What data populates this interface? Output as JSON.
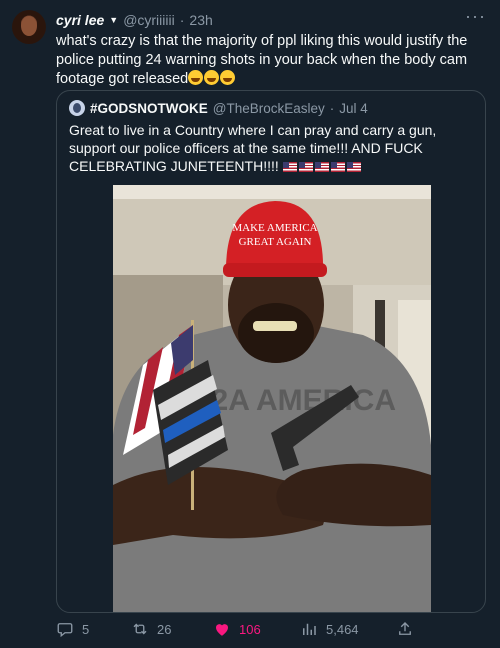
{
  "tweet": {
    "author_name": "cyri lee",
    "handle": "@cyriiiiii",
    "separator": "·",
    "time": "23h",
    "text": "what's crazy is that the majority of ppl liking this would justify the police putting 24 warning shots in your back when the body cam footage got released",
    "emoji_count": 3
  },
  "quote": {
    "author_name": "#GODSNOTWOKE",
    "handle": "@TheBrockEasley",
    "separator": "·",
    "date": "Jul 4",
    "text": "Great to live in a Country where I can pray and carry a gun, support our police officers at the same time!!! AND FUCK CELEBRATING JUNETEENTH!!!!",
    "flag_count": 5,
    "hat_text_line1": "MAKE AMERICA",
    "hat_text_line2": "GREAT AGAIN",
    "shirt_text": "1A 2A AMERICA"
  },
  "actions": {
    "replies": "5",
    "retweets": "26",
    "likes": "106",
    "views": "5,464"
  },
  "colors": {
    "background": "#15202b",
    "text": "#f7f9f9",
    "muted": "#8b98a5",
    "like": "#f91880",
    "border": "#38444d"
  }
}
